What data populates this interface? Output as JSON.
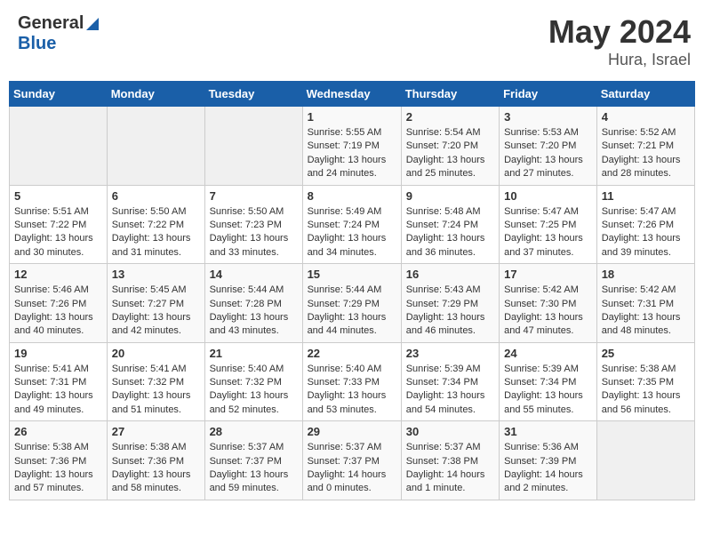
{
  "header": {
    "logo_general": "General",
    "logo_blue": "Blue",
    "month_title": "May 2024",
    "location": "Hura, Israel"
  },
  "days_of_week": [
    "Sunday",
    "Monday",
    "Tuesday",
    "Wednesday",
    "Thursday",
    "Friday",
    "Saturday"
  ],
  "weeks": [
    [
      {
        "day": "",
        "sunrise": "",
        "sunset": "",
        "daylight": "",
        "empty": true
      },
      {
        "day": "",
        "sunrise": "",
        "sunset": "",
        "daylight": "",
        "empty": true
      },
      {
        "day": "",
        "sunrise": "",
        "sunset": "",
        "daylight": "",
        "empty": true
      },
      {
        "day": "1",
        "sunrise": "Sunrise: 5:55 AM",
        "sunset": "Sunset: 7:19 PM",
        "daylight": "Daylight: 13 hours and 24 minutes."
      },
      {
        "day": "2",
        "sunrise": "Sunrise: 5:54 AM",
        "sunset": "Sunset: 7:20 PM",
        "daylight": "Daylight: 13 hours and 25 minutes."
      },
      {
        "day": "3",
        "sunrise": "Sunrise: 5:53 AM",
        "sunset": "Sunset: 7:20 PM",
        "daylight": "Daylight: 13 hours and 27 minutes."
      },
      {
        "day": "4",
        "sunrise": "Sunrise: 5:52 AM",
        "sunset": "Sunset: 7:21 PM",
        "daylight": "Daylight: 13 hours and 28 minutes."
      }
    ],
    [
      {
        "day": "5",
        "sunrise": "Sunrise: 5:51 AM",
        "sunset": "Sunset: 7:22 PM",
        "daylight": "Daylight: 13 hours and 30 minutes."
      },
      {
        "day": "6",
        "sunrise": "Sunrise: 5:50 AM",
        "sunset": "Sunset: 7:22 PM",
        "daylight": "Daylight: 13 hours and 31 minutes."
      },
      {
        "day": "7",
        "sunrise": "Sunrise: 5:50 AM",
        "sunset": "Sunset: 7:23 PM",
        "daylight": "Daylight: 13 hours and 33 minutes."
      },
      {
        "day": "8",
        "sunrise": "Sunrise: 5:49 AM",
        "sunset": "Sunset: 7:24 PM",
        "daylight": "Daylight: 13 hours and 34 minutes."
      },
      {
        "day": "9",
        "sunrise": "Sunrise: 5:48 AM",
        "sunset": "Sunset: 7:24 PM",
        "daylight": "Daylight: 13 hours and 36 minutes."
      },
      {
        "day": "10",
        "sunrise": "Sunrise: 5:47 AM",
        "sunset": "Sunset: 7:25 PM",
        "daylight": "Daylight: 13 hours and 37 minutes."
      },
      {
        "day": "11",
        "sunrise": "Sunrise: 5:47 AM",
        "sunset": "Sunset: 7:26 PM",
        "daylight": "Daylight: 13 hours and 39 minutes."
      }
    ],
    [
      {
        "day": "12",
        "sunrise": "Sunrise: 5:46 AM",
        "sunset": "Sunset: 7:26 PM",
        "daylight": "Daylight: 13 hours and 40 minutes."
      },
      {
        "day": "13",
        "sunrise": "Sunrise: 5:45 AM",
        "sunset": "Sunset: 7:27 PM",
        "daylight": "Daylight: 13 hours and 42 minutes."
      },
      {
        "day": "14",
        "sunrise": "Sunrise: 5:44 AM",
        "sunset": "Sunset: 7:28 PM",
        "daylight": "Daylight: 13 hours and 43 minutes."
      },
      {
        "day": "15",
        "sunrise": "Sunrise: 5:44 AM",
        "sunset": "Sunset: 7:29 PM",
        "daylight": "Daylight: 13 hours and 44 minutes."
      },
      {
        "day": "16",
        "sunrise": "Sunrise: 5:43 AM",
        "sunset": "Sunset: 7:29 PM",
        "daylight": "Daylight: 13 hours and 46 minutes."
      },
      {
        "day": "17",
        "sunrise": "Sunrise: 5:42 AM",
        "sunset": "Sunset: 7:30 PM",
        "daylight": "Daylight: 13 hours and 47 minutes."
      },
      {
        "day": "18",
        "sunrise": "Sunrise: 5:42 AM",
        "sunset": "Sunset: 7:31 PM",
        "daylight": "Daylight: 13 hours and 48 minutes."
      }
    ],
    [
      {
        "day": "19",
        "sunrise": "Sunrise: 5:41 AM",
        "sunset": "Sunset: 7:31 PM",
        "daylight": "Daylight: 13 hours and 49 minutes."
      },
      {
        "day": "20",
        "sunrise": "Sunrise: 5:41 AM",
        "sunset": "Sunset: 7:32 PM",
        "daylight": "Daylight: 13 hours and 51 minutes."
      },
      {
        "day": "21",
        "sunrise": "Sunrise: 5:40 AM",
        "sunset": "Sunset: 7:32 PM",
        "daylight": "Daylight: 13 hours and 52 minutes."
      },
      {
        "day": "22",
        "sunrise": "Sunrise: 5:40 AM",
        "sunset": "Sunset: 7:33 PM",
        "daylight": "Daylight: 13 hours and 53 minutes."
      },
      {
        "day": "23",
        "sunrise": "Sunrise: 5:39 AM",
        "sunset": "Sunset: 7:34 PM",
        "daylight": "Daylight: 13 hours and 54 minutes."
      },
      {
        "day": "24",
        "sunrise": "Sunrise: 5:39 AM",
        "sunset": "Sunset: 7:34 PM",
        "daylight": "Daylight: 13 hours and 55 minutes."
      },
      {
        "day": "25",
        "sunrise": "Sunrise: 5:38 AM",
        "sunset": "Sunset: 7:35 PM",
        "daylight": "Daylight: 13 hours and 56 minutes."
      }
    ],
    [
      {
        "day": "26",
        "sunrise": "Sunrise: 5:38 AM",
        "sunset": "Sunset: 7:36 PM",
        "daylight": "Daylight: 13 hours and 57 minutes."
      },
      {
        "day": "27",
        "sunrise": "Sunrise: 5:38 AM",
        "sunset": "Sunset: 7:36 PM",
        "daylight": "Daylight: 13 hours and 58 minutes."
      },
      {
        "day": "28",
        "sunrise": "Sunrise: 5:37 AM",
        "sunset": "Sunset: 7:37 PM",
        "daylight": "Daylight: 13 hours and 59 minutes."
      },
      {
        "day": "29",
        "sunrise": "Sunrise: 5:37 AM",
        "sunset": "Sunset: 7:37 PM",
        "daylight": "Daylight: 14 hours and 0 minutes."
      },
      {
        "day": "30",
        "sunrise": "Sunrise: 5:37 AM",
        "sunset": "Sunset: 7:38 PM",
        "daylight": "Daylight: 14 hours and 1 minute."
      },
      {
        "day": "31",
        "sunrise": "Sunrise: 5:36 AM",
        "sunset": "Sunset: 7:39 PM",
        "daylight": "Daylight: 14 hours and 2 minutes."
      },
      {
        "day": "",
        "sunrise": "",
        "sunset": "",
        "daylight": "",
        "empty": true
      }
    ]
  ]
}
